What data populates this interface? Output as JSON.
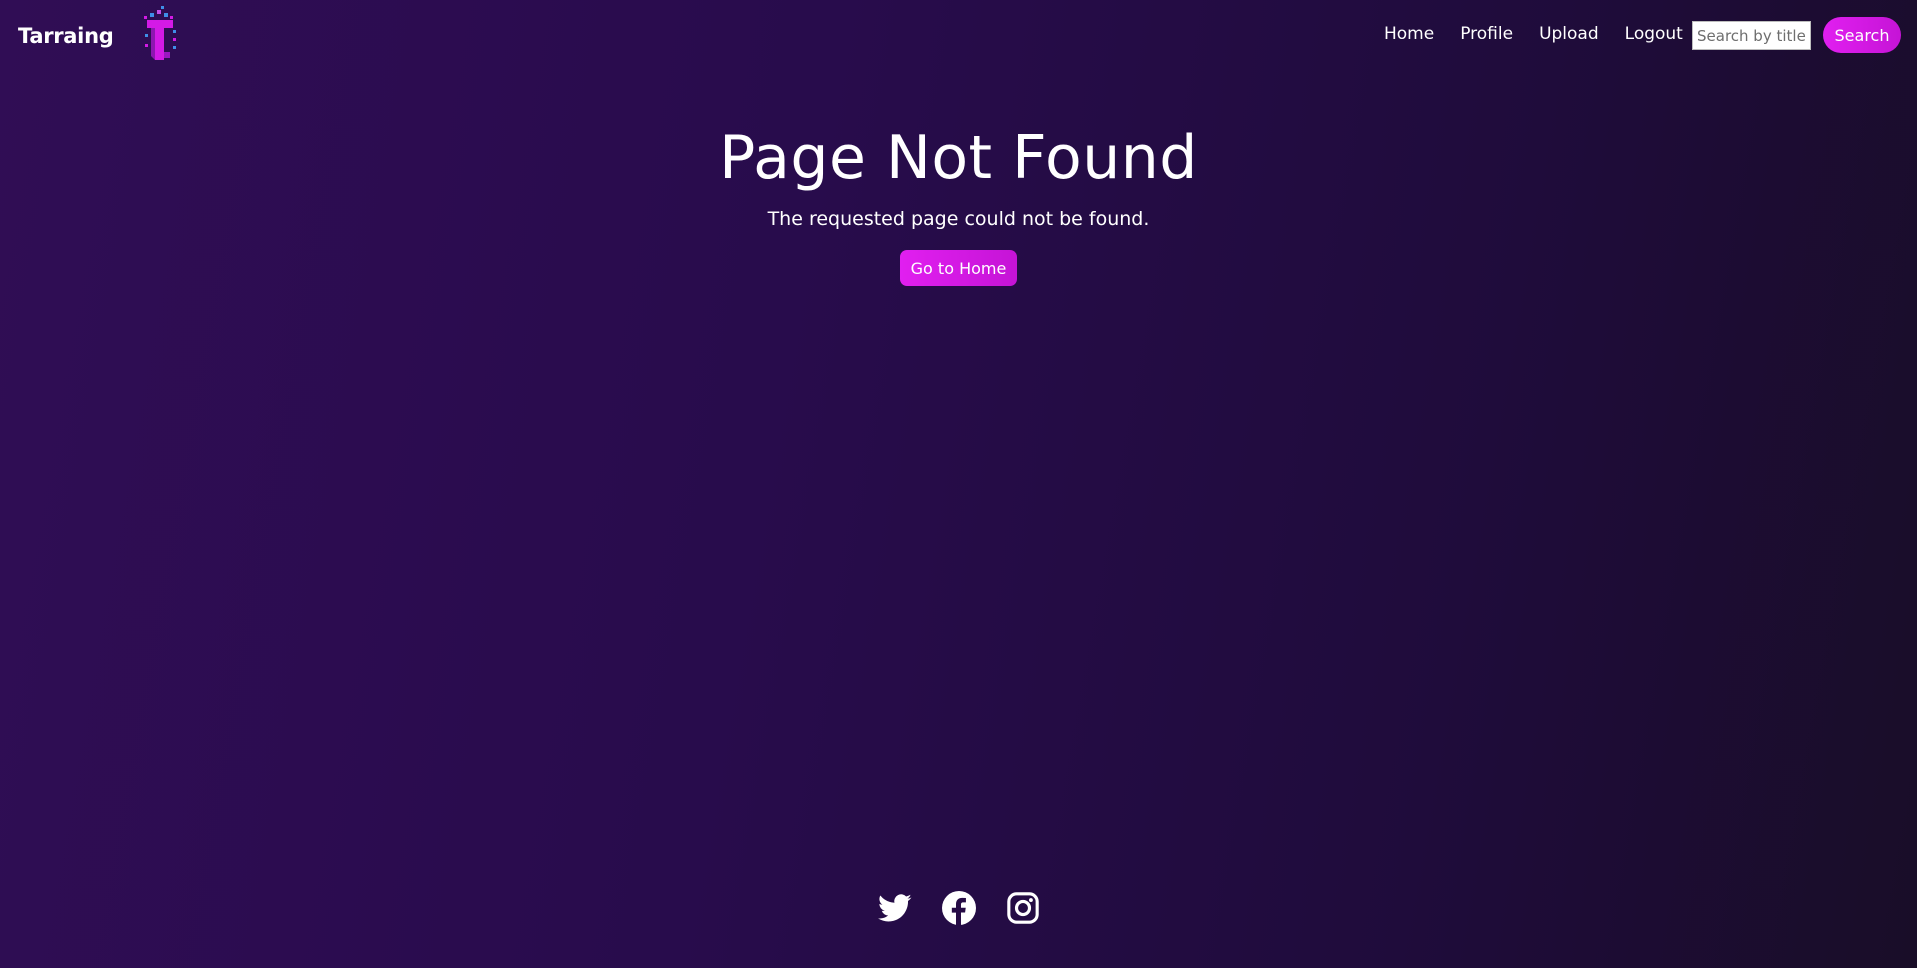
{
  "header": {
    "brand": "Tarraing",
    "logo_icon": "tarraing-logo-icon",
    "nav": [
      {
        "label": "Home"
      },
      {
        "label": "Profile"
      },
      {
        "label": "Upload"
      },
      {
        "label": "Logout"
      }
    ],
    "search": {
      "placeholder": "Search by title",
      "value": "",
      "button_label": "Search"
    }
  },
  "main": {
    "title": "Page Not Found",
    "message": "The requested page could not be found.",
    "home_button_label": "Go to Home"
  },
  "footer": {
    "social": [
      {
        "icon": "twitter-icon"
      },
      {
        "icon": "facebook-icon"
      },
      {
        "icon": "instagram-icon"
      }
    ]
  },
  "colors": {
    "background_start": "#300d55",
    "background_end": "#190d28",
    "accent": "#e11ff0",
    "text": "#ffffff"
  }
}
